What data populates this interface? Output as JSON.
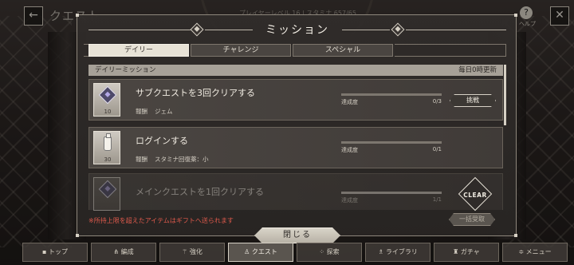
{
  "screen": {
    "title": "クエスト",
    "player_info": "プレイヤーレベル 16 | スタミナ 657/65",
    "help_label": "ヘルプ",
    "back_icon": "←",
    "close_icon": "✕"
  },
  "modal": {
    "title": "ミッション",
    "tabs": [
      {
        "label": "デイリー",
        "active": true
      },
      {
        "label": "チャレンジ",
        "active": false
      },
      {
        "label": "スペシャル",
        "active": false
      }
    ],
    "list_header": {
      "left": "デイリーミッション",
      "right": "毎日0時更新"
    },
    "missions": [
      {
        "title": "サブクエストを3回クリアする",
        "reward_label": "報酬",
        "reward": "ジェム",
        "thumb_count": "10",
        "thumb_icon": "gem-icon",
        "progress_label": "達成度",
        "progress_value": "0/3",
        "progress_fraction": 0,
        "action": "挑戦"
      },
      {
        "title": "ログインする",
        "reward_label": "報酬",
        "reward": "スタミナ回復薬：小",
        "thumb_count": "30",
        "thumb_icon": "stamina-potion-icon",
        "progress_label": "達成度",
        "progress_value": "0/1",
        "progress_fraction": 0
      },
      {
        "title": "メインクエストを1回クリアする",
        "thumb_icon": "gem-icon",
        "progress_label": "達成度",
        "progress_value": "1/1",
        "progress_fraction": 1,
        "badge": "CLEAR"
      }
    ],
    "gift_notice": "※所持上限を超えたアイテムはギフトへ送られます",
    "bulk_button": "一括受取",
    "close_button": "閉じる"
  },
  "bottom_nav": [
    {
      "label": "トップ",
      "icon": "home-icon"
    },
    {
      "label": "編成",
      "icon": "team-icon"
    },
    {
      "label": "強化",
      "icon": "enhance-icon"
    },
    {
      "label": "クエスト",
      "icon": "quest-icon",
      "active": true
    },
    {
      "label": "探索",
      "icon": "explore-icon"
    },
    {
      "label": "ライブラリ",
      "icon": "library-icon"
    },
    {
      "label": "ガチャ",
      "icon": "gacha-icon"
    },
    {
      "label": "メニュー",
      "icon": "menu-icon"
    }
  ],
  "colors": {
    "accent_light": "#e7e2d6",
    "panel": "#403b38",
    "notice_red": "#e05a4c"
  }
}
